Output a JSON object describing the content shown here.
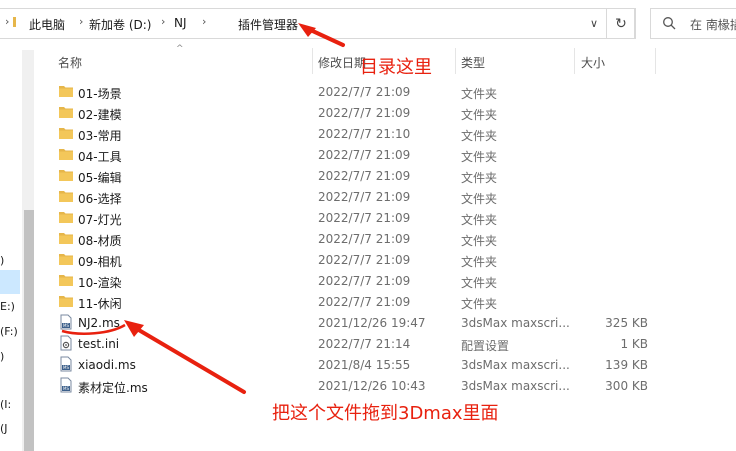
{
  "address_bar": {
    "crumbs": [
      "此电脑",
      "新加卷 (D:)",
      "NJ",
      "插件管理器"
    ],
    "search_placeholder": "在 南椽插"
  },
  "nav_pane": {
    "items": [
      ")",
      "E:)",
      "(F:)",
      ")",
      "(I:",
      "(J"
    ]
  },
  "columns": {
    "name": "名称",
    "date": "修改日期",
    "type": "类型",
    "size": "大小"
  },
  "files": [
    {
      "name": "01-场景",
      "date": "2022/7/7 21:09",
      "type": "文件夹",
      "size": "",
      "icon": "folder-icon"
    },
    {
      "name": "02-建模",
      "date": "2022/7/7 21:09",
      "type": "文件夹",
      "size": "",
      "icon": "folder-icon"
    },
    {
      "name": "03-常用",
      "date": "2022/7/7 21:10",
      "type": "文件夹",
      "size": "",
      "icon": "folder-icon"
    },
    {
      "name": "04-工具",
      "date": "2022/7/7 21:09",
      "type": "文件夹",
      "size": "",
      "icon": "folder-icon"
    },
    {
      "name": "05-编辑",
      "date": "2022/7/7 21:09",
      "type": "文件夹",
      "size": "",
      "icon": "folder-icon"
    },
    {
      "name": "06-选择",
      "date": "2022/7/7 21:09",
      "type": "文件夹",
      "size": "",
      "icon": "folder-icon"
    },
    {
      "name": "07-灯光",
      "date": "2022/7/7 21:09",
      "type": "文件夹",
      "size": "",
      "icon": "folder-icon"
    },
    {
      "name": "08-材质",
      "date": "2022/7/7 21:09",
      "type": "文件夹",
      "size": "",
      "icon": "folder-icon"
    },
    {
      "name": "09-相机",
      "date": "2022/7/7 21:09",
      "type": "文件夹",
      "size": "",
      "icon": "folder-icon"
    },
    {
      "name": "10-渲染",
      "date": "2022/7/7 21:09",
      "type": "文件夹",
      "size": "",
      "icon": "folder-icon"
    },
    {
      "name": "11-休闲",
      "date": "2022/7/7 21:09",
      "type": "文件夹",
      "size": "",
      "icon": "folder-icon"
    },
    {
      "name": "NJ2.ms",
      "date": "2021/12/26 19:47",
      "type": "3dsMax maxscri...",
      "size": "325 KB",
      "icon": "maxscript-file-icon"
    },
    {
      "name": "test.ini",
      "date": "2022/7/7 21:14",
      "type": "配置设置",
      "size": "1 KB",
      "icon": "ini-file-icon"
    },
    {
      "name": "xiaodi.ms",
      "date": "2021/8/4 15:55",
      "type": "3dsMax maxscri...",
      "size": "139 KB",
      "icon": "maxscript-file-icon"
    },
    {
      "name": "素材定位.ms",
      "date": "2021/12/26 10:43",
      "type": "3dsMax maxscri...",
      "size": "300 KB",
      "icon": "maxscript-file-icon"
    }
  ],
  "annotations": {
    "directory_note": "目录这里",
    "drag_note": "把这个文件拖到3Dmax里面"
  },
  "colors": {
    "annotation_red": "#e8210f",
    "folder_yellow": "#e6b64a",
    "selection_blue": "#cce8ff"
  }
}
